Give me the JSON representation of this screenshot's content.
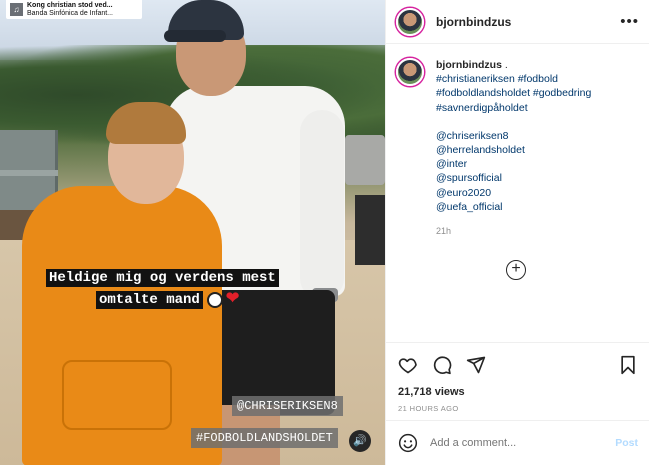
{
  "media": {
    "music_title": "Kong christian stod ved...",
    "music_artist": "Banda Sinfónica de Infant...",
    "overlay_line1": "Heldige mig og verdens mest",
    "overlay_line2": "omtalte mand",
    "tag_user": "@CHRISERIKSEN8",
    "tag_hashtag": "#FODBOLDLANDSHOLDET"
  },
  "header": {
    "username": "bjornbindzus",
    "more": "•••"
  },
  "caption": {
    "username": "bjornbindzus",
    "suffix": " .",
    "hashtags": [
      "#christianeriksen #fodbold",
      "#fodboldlandsholdet #godbedring",
      "#savnerdigpåholdet"
    ],
    "mentions": [
      "@chriseriksen8",
      "@herrelandsholdet",
      "@inter",
      "@spursofficial",
      "@euro2020",
      "@uefa_official"
    ],
    "age": "21h"
  },
  "actions": {
    "views": "21,718 views",
    "timestamp": "21 HOURS AGO"
  },
  "comment": {
    "placeholder": "Add a comment...",
    "post_label": "Post"
  },
  "icons": {
    "more": "more-dots-icon",
    "like": "heart-icon",
    "comment": "comment-bubble-icon",
    "share": "paper-plane-icon",
    "save": "bookmark-icon",
    "emoji": "smiley-icon",
    "load_more": "plus-circle-icon",
    "audio": "speaker-icon"
  },
  "colors": {
    "link": "#00376b",
    "muted": "#8e8e8e",
    "post_button": "#b3dbff",
    "story_ring": "#d6249f"
  }
}
